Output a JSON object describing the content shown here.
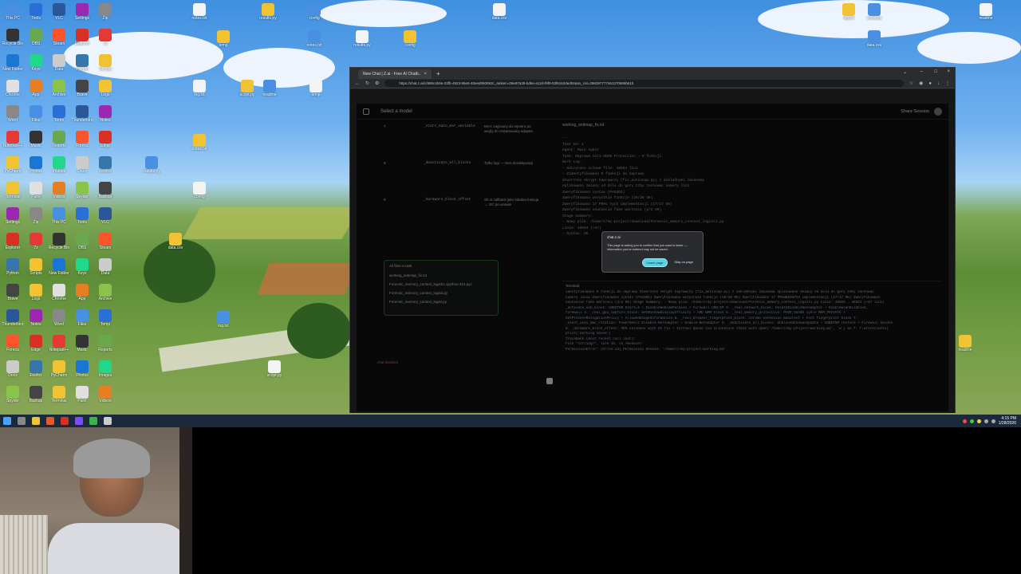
{
  "desktop": {
    "icon_labels": [
      "This PC",
      "Recycle Bin",
      "New Folder",
      "Chrome",
      "Word",
      "Notepad++",
      "PyCharm",
      "Terminal",
      "Settings",
      "Explorer",
      "Python",
      "Brave",
      "Thunderbird",
      "Foreca",
      "Docs",
      "Spyder",
      "Tools",
      "OBS",
      "Keys",
      "App",
      "Files",
      "Music",
      "Photos",
      "Paint",
      "Zip",
      "7z",
      "Scripts",
      "Logs",
      "Notes",
      "Edge",
      "Firefox",
      "Backup",
      "VLC",
      "Steam",
      "Data",
      "Archive",
      "Temp",
      "Reports",
      "Images",
      "Videos"
    ],
    "desktop_file_labels": [
      "notes.txt",
      "results.py",
      "config",
      "data.csv",
      "log.txt",
      "script.py",
      "readme",
      "temp"
    ]
  },
  "taskbar": {
    "clock_time": "4:15 PM",
    "clock_date": "1/28/2026"
  },
  "browser": {
    "tab_title": "New Chat | Z.ai - Free AI Chatb...",
    "tab_close": "×",
    "new_tab": "+",
    "url": "https://chat.z.ai/c/986c4b9a-33fb-4923-95e6-40eed060093c_atoken=09e97a35-bd6e-a12d-f9f0-03f6162ded04&ss_cnt=296397777461270686b51b",
    "window_controls": [
      "–",
      "□",
      "×"
    ]
  },
  "app": {
    "model_select": "Select a model",
    "share": "Share Session",
    "table_rows": [
      {
        "num": "7",
        "code": "_start_nato_mer_variable",
        "desc": "MAC zagruany do rejestru po wejdy do restartowany adapter"
      },
      {
        "num": "8",
        "code": "_deactivate_all_blocks",
        "desc": "Tylko logi — zero dezaktywacji"
      },
      {
        "num": "9",
        "code": "_hardware_block_offset",
        "desc": "Sh in callback jako lokalna funkcja → GC po usuwie"
      }
    ],
    "files_header": "All files in task",
    "files": [
      "working_antimap_fix.txt",
      "Forensic_memory_context_logisti1.cpython-312.pyc",
      "Forensic_memory_context_logisti.py",
      "Forensic_memory_context_logist.py"
    ],
    "chat_hint": "chat kludzies",
    "doc_title": "working_antimap_fix.txt",
    "doc_lines": [
      "---",
      "Task ID: 1",
      "Agent: Main Agent",
      "Task: Naprawa Anti-SNAB Protection — 9 funkcji",
      "",
      "Work Log:",
      "- Odczytano oulowe file: 48584 lini",
      "- Zidentyfikowano 9 funkcji do naprawy",
      "  Stworzono skrypt naprawczy (fix_antisnap.py) z dokladnymi zmianami",
      "  Aplikowano zmiany od dolu do gory tzby zachowac numery lini",
      "  Zweryfikowano syntax (PASSED)",
      "  Zweryfikowano wszystkie funkcje (26/26 OK)",
      "  Zweryfikowano 17 PRAC nych implementacji (17/17 OK)",
      "  Zweryfikowano usuniecie fake wartosci (2/2 OK)",
      "",
      "Stage Summary:",
      "- Nowy plik: /home/z/my-project/download/Forensic_memory_context_logisti.py",
      "  Linie: 48584 (+47)",
      "- Syntax: OK"
    ],
    "terminal_title": "Terminal",
    "terminal_lines": [
      "identyfikowano 9 funkcji do naprawy   Stworzono skrypt naprawczy (fix_antisnap.py) z dokladnymi zmianami   Aplikowano zmiany od dolu do gory zeby zachowac",
      "numery linii   Zweryfikowano syntax (PASSED)   Zweryfikowano wszystkie funkcje (26/26 OK)   Zweryfikowano 17 PRAWDZIWYCH implementacji (17/17 OK)   Zweryfikowano",
      "usuniecie fake wartosci (2/2 OK)  Stage Summary:  - Nowy plik: /home/z/my-project/download/Forensic_memory_context_logisti.py  Linie: 48584 → 48631 (+47 lini)",
      "_activate_usb_block: USBSTOR Start=4 + DisableWebcamPurpose + Firewall USB/IP 3. _real_network_block: UnsafeDisableNetAdapter + EnableWlanDisabled,",
      "firewall 4. _real_gpu_capture_block: SetWindowDisplayAffinity + AMD WMR block 5. _real_memory_protection: PAGE_GUARD cykle MEM_PRIVATE +",
      "SetProcessMitigationPolicy + AllowedUsageInformation 6. _real_browser_fingerprint_block: chrome extension manifest + Font fingerprint block 7.",
      "_start_auto_mac_rotation: PowerShell Disable-NetAdapter / Enable-NetAdapter 8. _deactivate_all_blocks: UnblockWindowsUpdate + USBSTOR restore + Firewall delete",
      "9. _hardware_block_offset: SEH callback with GC fix + Virtual Queue via allocation check  with open('/home/z/my-project/working.md', 'w') as f: f.write(notes)",
      "print('working saved')",
      "",
      "Traceback (most recent call last):",
      "  File \"<string>\", line 15, in <module>",
      "PermissionError: [Errno 13] Permission denied: '/home/z/my-project/working.md'"
    ]
  },
  "dialog": {
    "site": "chat.z.ai",
    "message": "This page is asking you to confirm that you want to leave — information you've entered may not be saved.",
    "leave": "Leave page",
    "stay": "Stay on page"
  },
  "colors": {
    "accent": "#5bd0e0",
    "file_panel_border": "#2f6b3a"
  }
}
